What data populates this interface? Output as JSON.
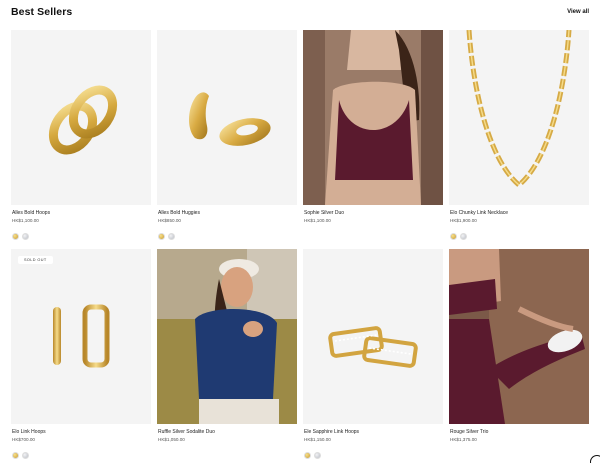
{
  "header": {
    "title": "Best Sellers",
    "view_all": "View all"
  },
  "products": [
    {
      "name": "Alles Bold Hoops",
      "price": "HK$1,100.00",
      "swatches": [
        "gold",
        "silver"
      ]
    },
    {
      "name": "Alles Bold Huggies",
      "price": "HK$850.00",
      "swatches": [
        "gold",
        "silver"
      ]
    },
    {
      "name": "Sophie Silver Duo",
      "price": "HK$1,100.00",
      "swatches": []
    },
    {
      "name": "Elo Chunky Link Necklace",
      "price": "HK$1,900.00",
      "swatches": [
        "gold",
        "silver"
      ]
    },
    {
      "name": "Elo Link Hoops",
      "price": "HK$700.00",
      "badge": "SOLD OUT",
      "swatches": [
        "gold",
        "silver"
      ]
    },
    {
      "name": "Ruffle Silver Sodalite Duo",
      "price": "HK$1,050.00",
      "swatches": []
    },
    {
      "name": "Ele Sapphire Link Hoops",
      "price": "HK$1,150.00",
      "swatches": [
        "gold",
        "silver"
      ]
    },
    {
      "name": "Rouge Silver Trio",
      "price": "HK$1,375.00",
      "swatches": []
    }
  ],
  "colors": {
    "gold": "#d4a843",
    "silver": "#c6c9cf",
    "image_bg": "#f4f4f4"
  }
}
